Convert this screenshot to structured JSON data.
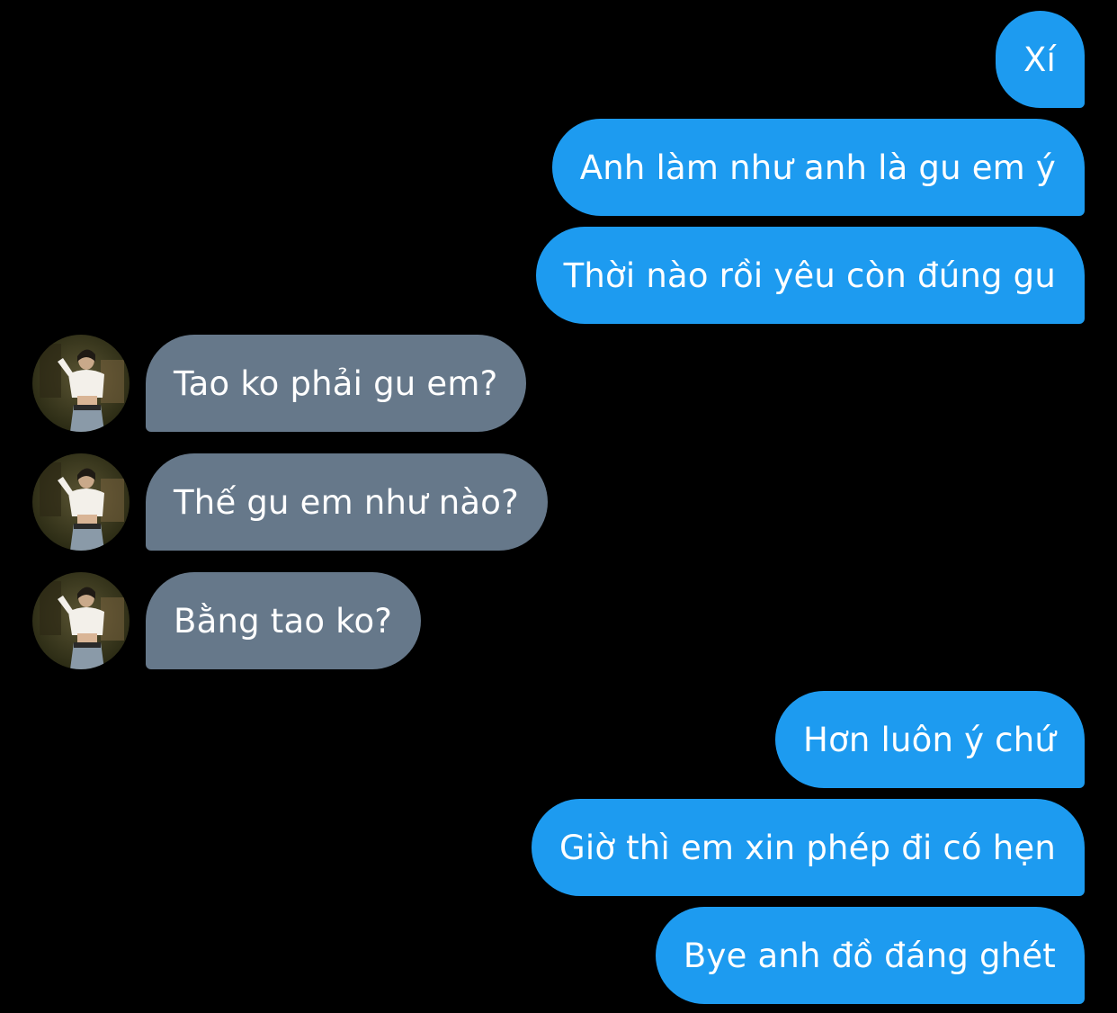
{
  "messages": [
    {
      "side": "sent",
      "text": "Xí"
    },
    {
      "side": "sent",
      "text": "Anh làm như anh là gu em ý"
    },
    {
      "side": "sent",
      "text": "Thời nào rồi yêu còn đúng gu"
    },
    {
      "side": "received",
      "text": "Tao ko phải gu em?",
      "avatar": "profile-avatar"
    },
    {
      "side": "received",
      "text": "Thế gu em như nào?",
      "avatar": "profile-avatar"
    },
    {
      "side": "received",
      "text": "Bằng tao ko?",
      "avatar": "profile-avatar"
    },
    {
      "side": "sent",
      "text": "Hơn luôn ý chứ"
    },
    {
      "side": "sent",
      "text": "Giờ thì em xin phép đi có hẹn"
    },
    {
      "side": "sent",
      "text": "Bye anh đồ đáng ghét"
    }
  ],
  "colors": {
    "background": "#000000",
    "sent_bubble": "#1d9bf0",
    "received_bubble": "#66788a",
    "text": "#ffffff"
  }
}
